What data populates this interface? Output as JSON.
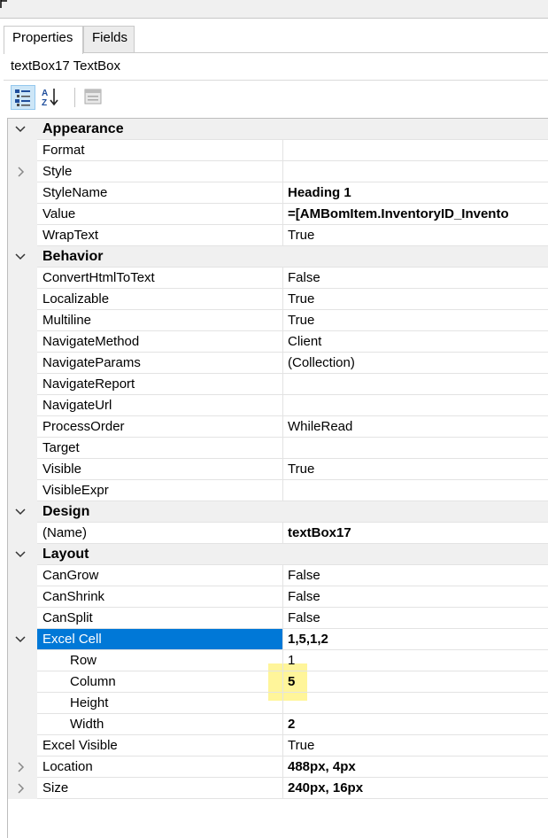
{
  "tabs": [
    {
      "label": "Properties",
      "active": true
    },
    {
      "label": "Fields",
      "active": false
    }
  ],
  "object_title": "textBox17  TextBox",
  "toolbar": {
    "categorized_icon": "categorized-icon",
    "alphabetical_icon": "alphabetical-sort-icon",
    "property_pages_icon": "property-pages-icon"
  },
  "colors": {
    "selection": "#0078d7",
    "highlight": "#fff59a",
    "category_bg": "#f0f0f0"
  },
  "properties": [
    {
      "type": "category",
      "name": "Appearance",
      "expander": "collapse"
    },
    {
      "name": "Format",
      "value": ""
    },
    {
      "name": "Style",
      "value": "",
      "expander": "expand"
    },
    {
      "name": "StyleName",
      "value": "Heading 1",
      "bold": true
    },
    {
      "name": "Value",
      "value": "=[AMBomItem.InventoryID_Invento",
      "bold": true
    },
    {
      "name": "WrapText",
      "value": "True"
    },
    {
      "type": "category",
      "name": "Behavior",
      "expander": "collapse"
    },
    {
      "name": "ConvertHtmlToText",
      "value": "False"
    },
    {
      "name": "Localizable",
      "value": "True"
    },
    {
      "name": "Multiline",
      "value": "True"
    },
    {
      "name": "NavigateMethod",
      "value": "Client"
    },
    {
      "name": "NavigateParams",
      "value": "(Collection)"
    },
    {
      "name": "NavigateReport",
      "value": ""
    },
    {
      "name": "NavigateUrl",
      "value": ""
    },
    {
      "name": "ProcessOrder",
      "value": "WhileRead"
    },
    {
      "name": "Target",
      "value": ""
    },
    {
      "name": "Visible",
      "value": "True"
    },
    {
      "name": "VisibleExpr",
      "value": ""
    },
    {
      "type": "category",
      "name": "Design",
      "expander": "collapse"
    },
    {
      "name": "(Name)",
      "value": "textBox17",
      "bold": true
    },
    {
      "type": "category",
      "name": "Layout",
      "expander": "collapse"
    },
    {
      "name": "CanGrow",
      "value": "False"
    },
    {
      "name": "CanShrink",
      "value": "False"
    },
    {
      "name": "CanSplit",
      "value": "False"
    },
    {
      "name": "Excel Cell",
      "value": "1,5,1,2",
      "bold": true,
      "selected": true,
      "expander": "collapse"
    },
    {
      "name": "Row",
      "value": "1",
      "indent": true
    },
    {
      "name": "Column",
      "value": "5",
      "bold": true,
      "indent": true,
      "highlighted": true
    },
    {
      "name": "Height",
      "value": "",
      "indent": true
    },
    {
      "name": "Width",
      "value": "2",
      "bold": true,
      "indent": true
    },
    {
      "name": "Excel Visible",
      "value": "True"
    },
    {
      "name": "Location",
      "value": "488px, 4px",
      "bold": true,
      "expander": "expand"
    },
    {
      "name": "Size",
      "value": "240px, 16px",
      "bold": true,
      "expander": "expand"
    }
  ]
}
